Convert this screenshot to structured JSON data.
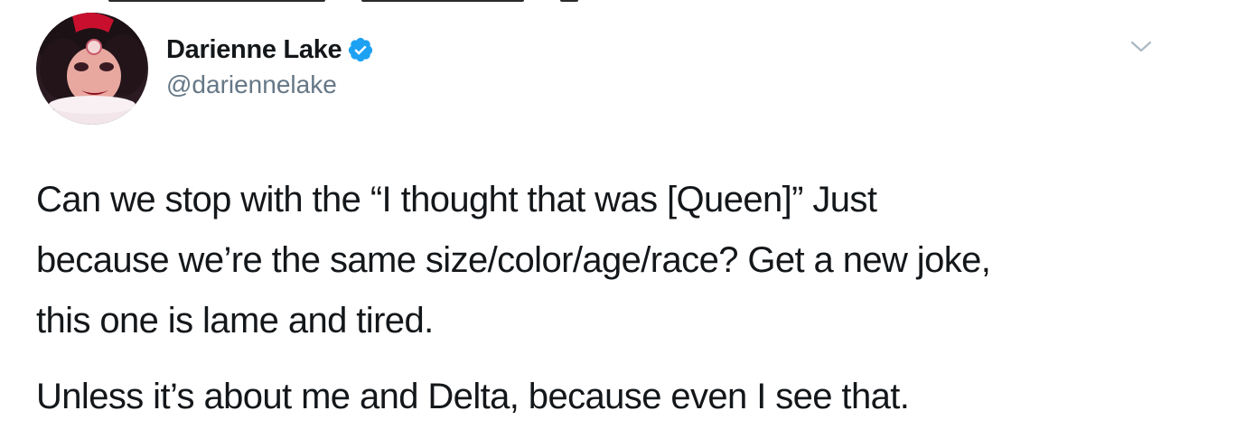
{
  "author": {
    "display_name": "Darienne Lake",
    "handle": "@dariennelake",
    "verified": true,
    "avatar_icon": "profile-photo",
    "verified_icon": "verified-badge-icon"
  },
  "menu": {
    "icon": "chevron-down-icon"
  },
  "tweet": {
    "paragraph1_lines": [
      "Can we stop with the “I thought that was [Queen]” Just",
      "because we’re the same size/color/age/race? Get a new joke,",
      "this one is lame and tired."
    ],
    "paragraph2": "Unless it’s about me and Delta, because even I see that."
  },
  "colors": {
    "text": "#14171a",
    "secondary": "#657786",
    "verified": "#1da1f2",
    "caret": "#aab8c2"
  }
}
